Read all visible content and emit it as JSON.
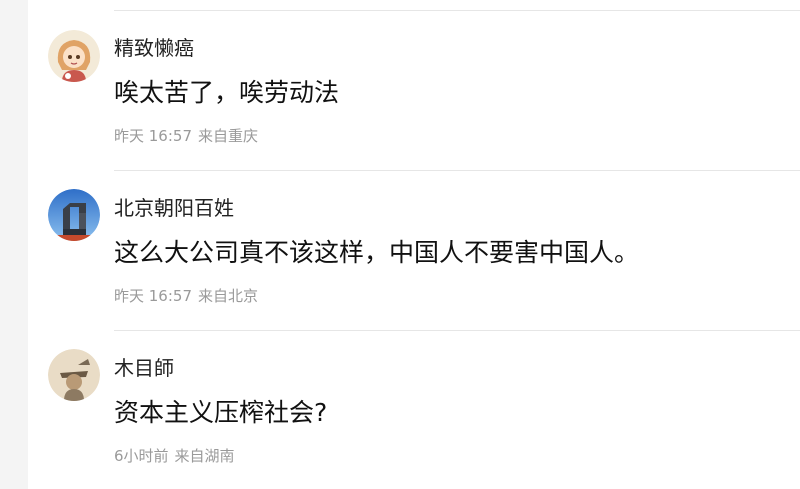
{
  "comments": [
    {
      "username": "精致懒癌",
      "text": "唉太苦了，唉劳动法",
      "time": "昨天 16:57",
      "location": "来自重庆",
      "avatar_icon": "anime-girl-avatar",
      "avatar_color": "#f1c9a8"
    },
    {
      "username": "北京朝阳百姓",
      "text": "这么大公司真不该这样，中国人不要害中国人。",
      "time": "昨天 16:57",
      "location": "来自北京",
      "avatar_icon": "cctv-building-avatar",
      "avatar_color": "#3e7fd0"
    },
    {
      "username": "木目師",
      "text": "资本主义压榨社会?",
      "time": "6小时前",
      "location": "来自湖南",
      "avatar_icon": "sketch-figure-avatar",
      "avatar_color": "#d9c2a0"
    }
  ]
}
